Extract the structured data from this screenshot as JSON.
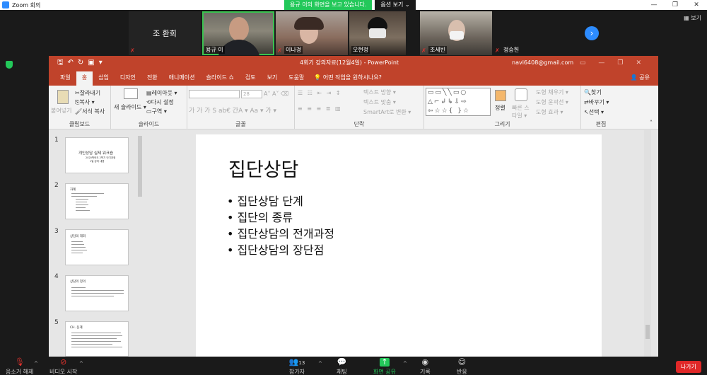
{
  "zoom": {
    "window_title": "Zoom 회의",
    "share_banner": "용규 이의 화면을 보고 있습니다.",
    "view_options": "옵션 보기 ⌄",
    "view_toggle": "보기",
    "participants": [
      {
        "name": "조 환희",
        "video": false
      },
      {
        "name": "용규 이",
        "video": true
      },
      {
        "name": "이나경",
        "video": true
      },
      {
        "name": "오현정",
        "video": true
      },
      {
        "name": "조세빈",
        "video": true
      },
      {
        "name": "정승헌",
        "video": true
      }
    ],
    "toolbar": {
      "mute": "음소거 해제",
      "video": "비디오 시작",
      "participants": "참가자",
      "participant_count": "13",
      "chat": "채팅",
      "share": "화면 공유",
      "record": "기록",
      "reactions": "반응",
      "leave": "나가기"
    }
  },
  "powerpoint": {
    "doc_title": "4회기 강의자료(12월4일)  -  PowerPoint",
    "account": "navi6408@gmail.com",
    "tabs": [
      "파일",
      "홈",
      "삽입",
      "디자인",
      "전환",
      "애니메이션",
      "슬라이드 쇼",
      "검토",
      "보기",
      "도움말"
    ],
    "active_tab": "홈",
    "tell_me": "어떤 작업을 원하시나요?",
    "share": "공유",
    "ribbon": {
      "clipboard": {
        "paste": "붙여넣기",
        "cut": "잘라내기",
        "copy": "복사 ▾",
        "format_painter": "서식 복사",
        "label": "클립보드"
      },
      "slides": {
        "new_slide": "새 슬라이드 ▾",
        "layout": "레이아웃 ▾",
        "reset": "다시 설정",
        "section": "구역 ▾",
        "label": "슬라이드"
      },
      "font": {
        "size": "28",
        "label": "글꼴",
        "styles": "가 가 가 S ab€ 간A ▾  Aa ▾  가 ▾"
      },
      "paragraph": {
        "text_direction": "텍스트 방향 ▾",
        "align_text": "텍스트 맞춤 ▾",
        "smartart": "SmartArt로 변환 ▾",
        "label": "단락"
      },
      "drawing": {
        "arrange": "정렬",
        "quick_styles": "빠른 스타일 ▾",
        "shape_fill": "도형 채우기 ▾",
        "shape_outline": "도형 윤곽선 ▾",
        "shape_effects": "도형 효과 ▾",
        "label": "그리기"
      },
      "editing": {
        "find": "찾기",
        "replace": "바꾸기 ▾",
        "select": "선택 ▾",
        "label": "편집"
      }
    },
    "thumbnails": [
      {
        "num": "1",
        "lines": [
          "개인상담 실제 워크숍",
          "2020학년도 2학기 단기과정",
          "1일 강의 내용"
        ]
      },
      {
        "num": "2",
        "lines": [
          "차례"
        ]
      },
      {
        "num": "3",
        "lines": [
          "상담의 대화"
        ]
      },
      {
        "num": "4",
        "lines": [
          "상담의 정의"
        ]
      },
      {
        "num": "5",
        "lines": [
          "CH. 동계"
        ]
      }
    ],
    "slide": {
      "title": "집단상담",
      "bullets": [
        "집단상담 단계",
        "집단의 종류",
        "집단상담의 전개과정",
        "집단상담의 장단점"
      ]
    }
  }
}
